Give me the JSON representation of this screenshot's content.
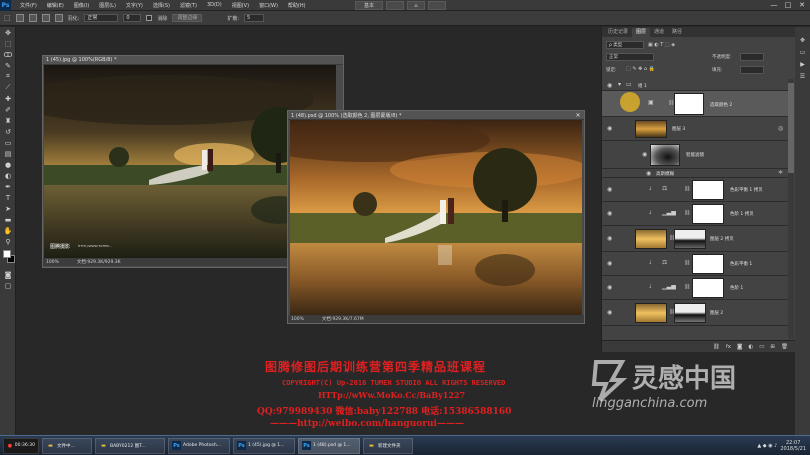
{
  "app": {
    "logo": "Ps",
    "menus": [
      "文件(F)",
      "编辑(E)",
      "图像(I)",
      "图层(L)",
      "文字(Y)",
      "选择(S)",
      "滤镜(T)",
      "3D(D)",
      "视图(V)",
      "窗口(W)",
      "帮助(H)"
    ],
    "center_box_1": "基本",
    "center_box_2": "",
    "center_box_3": "",
    "window_controls": [
      "—",
      "□",
      "✕"
    ]
  },
  "options": {
    "mode_label": "羽化:",
    "mode_value": "正常",
    "size_value": "0",
    "antialias_label": "消除",
    "refine_button": "调整边缘",
    "expand_label": "扩散:",
    "expand_value": "5"
  },
  "toolbar": {
    "icons": [
      "move-icon",
      "marquee-icon",
      "lasso-icon",
      "quick-select-icon",
      "crop-icon",
      "eyedropper-icon",
      "healing-icon",
      "brush-icon",
      "stamp-icon",
      "history-brush-icon",
      "eraser-icon",
      "gradient-icon",
      "blur-icon",
      "dodge-icon",
      "pen-icon",
      "type-icon",
      "path-select-icon",
      "shape-icon",
      "hand-icon",
      "zoom-icon"
    ]
  },
  "doc1": {
    "title": "1 (45).jpg @ 100%(RGB/8) *",
    "zoom": "100%",
    "status": "文档:929.3K/929.3K",
    "logo_text": "图腾摄影",
    "logo_sub": "HTTP://WWW.TOTEM..."
  },
  "doc2": {
    "title": "1 (48).psd @ 100% (选取颜色 2, 图层蒙版/8) *",
    "zoom": "100%",
    "status": "文档:929.3K/7.67M"
  },
  "panel": {
    "tabs": [
      "历史记录",
      "图层",
      "通道",
      "路径"
    ],
    "active_tab": "图层",
    "filter_label": "ρ 类型",
    "blend_mode": "正常",
    "opacity_label": "不透明度:",
    "lock_label": "锁定:",
    "fill_label": "填充:",
    "layers": [
      {
        "name": "组 1",
        "kind": "group"
      },
      {
        "name": "选取颜色 2",
        "kind": "adjustment"
      },
      {
        "name": "图层 3",
        "kind": "image"
      },
      {
        "name": "智能滤镜",
        "kind": "filter-mask"
      },
      {
        "name": "高斯模糊",
        "kind": "filter"
      },
      {
        "name": "色彩平衡 1 拷贝",
        "kind": "adjustment"
      },
      {
        "name": "色阶 1 拷贝",
        "kind": "adjustment"
      },
      {
        "name": "图层 2 拷贝",
        "kind": "image"
      },
      {
        "name": "色彩平衡 1",
        "kind": "adjustment"
      },
      {
        "name": "色阶 1",
        "kind": "adjustment"
      },
      {
        "name": "图层 2",
        "kind": "image"
      }
    ],
    "bottom_icons": [
      "link-icon",
      "fx-icon",
      "mask-icon",
      "adjustment-icon",
      "folder-icon",
      "new-layer-icon",
      "trash-icon"
    ]
  },
  "watermark": {
    "title": "图腾修图后期训练营第四季精品班课程",
    "copyright": "COPYRIGHT(C) Up-2016 TUMEN STUDIO ALL RIGHTS RESERVED",
    "url": "HTTp://wWw.MoKo.Cc/BaBy1227",
    "contact": "QQ:979989430  微信:baby122788  电话:15386588160",
    "weibo": "———http://weibo.com/hanguorui———"
  },
  "brand": {
    "name": "灵感中国",
    "url": "lingganchina.com"
  },
  "taskbar": {
    "items": [
      {
        "label": "00:36:30",
        "icon": "record-icon"
      },
      {
        "label": "文件中...",
        "icon": "folder-icon"
      },
      {
        "label": "BABY0212 图T...",
        "icon": "folder-icon"
      },
      {
        "label": "Adobe Photosh...",
        "icon": "ps-icon"
      },
      {
        "label": "1 (45).jpg @ 1...",
        "icon": "ps-icon"
      },
      {
        "label": "1 (48).psd @ 1...",
        "icon": "ps-icon"
      },
      {
        "label": "新建文件夹",
        "icon": "folder-icon"
      }
    ],
    "time": "22:07",
    "date": "2018/5/21"
  },
  "colors": {
    "watermark_red": "#e02020",
    "ps_blue": "#39a0f5"
  }
}
